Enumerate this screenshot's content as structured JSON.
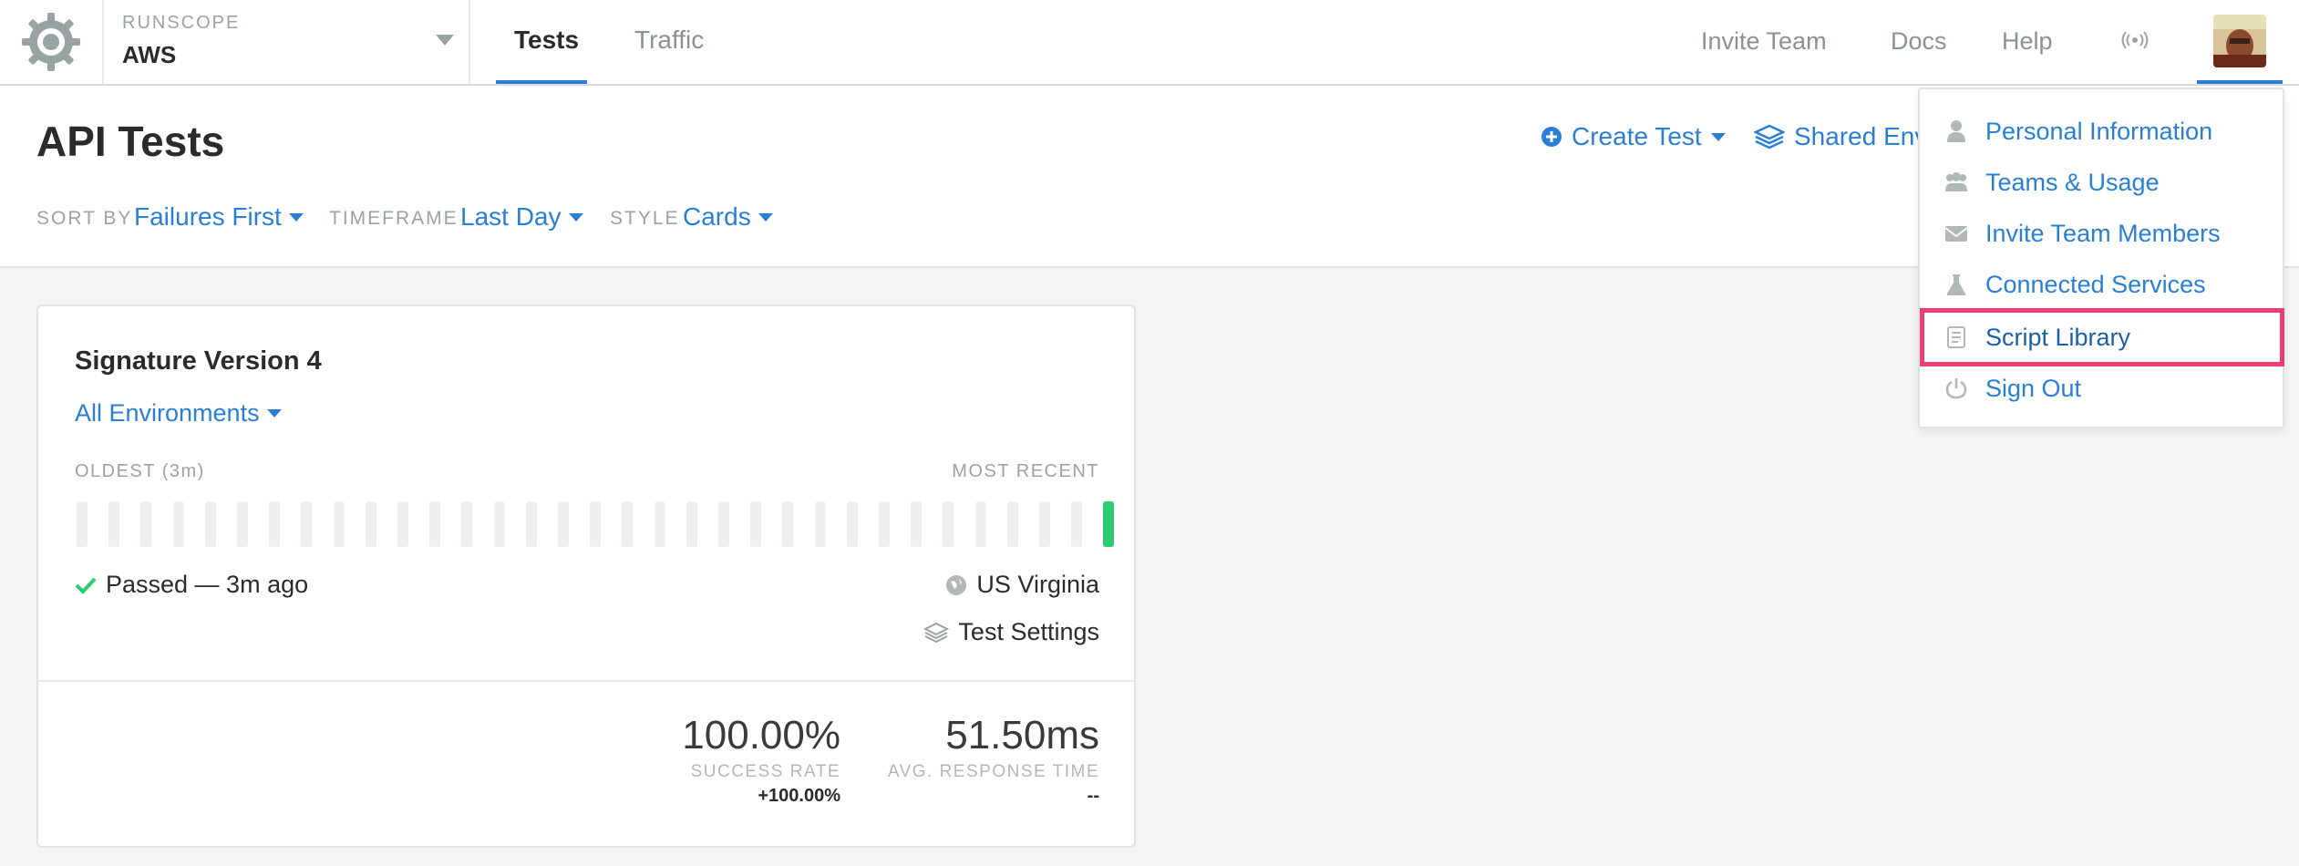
{
  "topbar": {
    "account_label": "RUNSCOPE",
    "account_name": "AWS",
    "tabs": [
      {
        "label": "Tests",
        "active": true
      },
      {
        "label": "Traffic",
        "active": false
      }
    ],
    "links": [
      "Invite Team",
      "Docs",
      "Help"
    ],
    "broadcast_icon": "broadcast-icon"
  },
  "header": {
    "title": "API Tests",
    "create_test": "Create Test",
    "shared_env": "Shared Env",
    "filters": {
      "sort_label": "SORT BY",
      "sort_value": "Failures First",
      "timeframe_label": "TIMEFRAME",
      "timeframe_value": "Last Day",
      "style_label": "STYLE",
      "style_value": "Cards"
    }
  },
  "card": {
    "title": "Signature Version 4",
    "environment": "All Environments",
    "oldest_label": "OLDEST (3m)",
    "recent_label": "MOST RECENT",
    "status": "Passed — 3m ago",
    "region": "US Virginia",
    "settings": "Test Settings",
    "success_rate": "100.00%",
    "success_label": "SUCCESS RATE",
    "success_delta": "+100.00%",
    "response_time": "51.50ms",
    "response_label": "AVG. RESPONSE TIME",
    "response_delta": "--"
  },
  "dropdown": {
    "items": [
      {
        "label": "Personal Information",
        "icon": "user-icon"
      },
      {
        "label": "Teams & Usage",
        "icon": "team-icon"
      },
      {
        "label": "Invite Team Members",
        "icon": "envelope-icon"
      },
      {
        "label": "Connected Services",
        "icon": "flask-icon"
      },
      {
        "label": "Script Library",
        "icon": "script-icon",
        "highlighted": true
      },
      {
        "label": "Sign Out",
        "icon": "power-icon"
      }
    ]
  },
  "colors": {
    "accent": "#2a7fd4",
    "success": "#2ecc71",
    "highlight": "#ee3f75"
  }
}
